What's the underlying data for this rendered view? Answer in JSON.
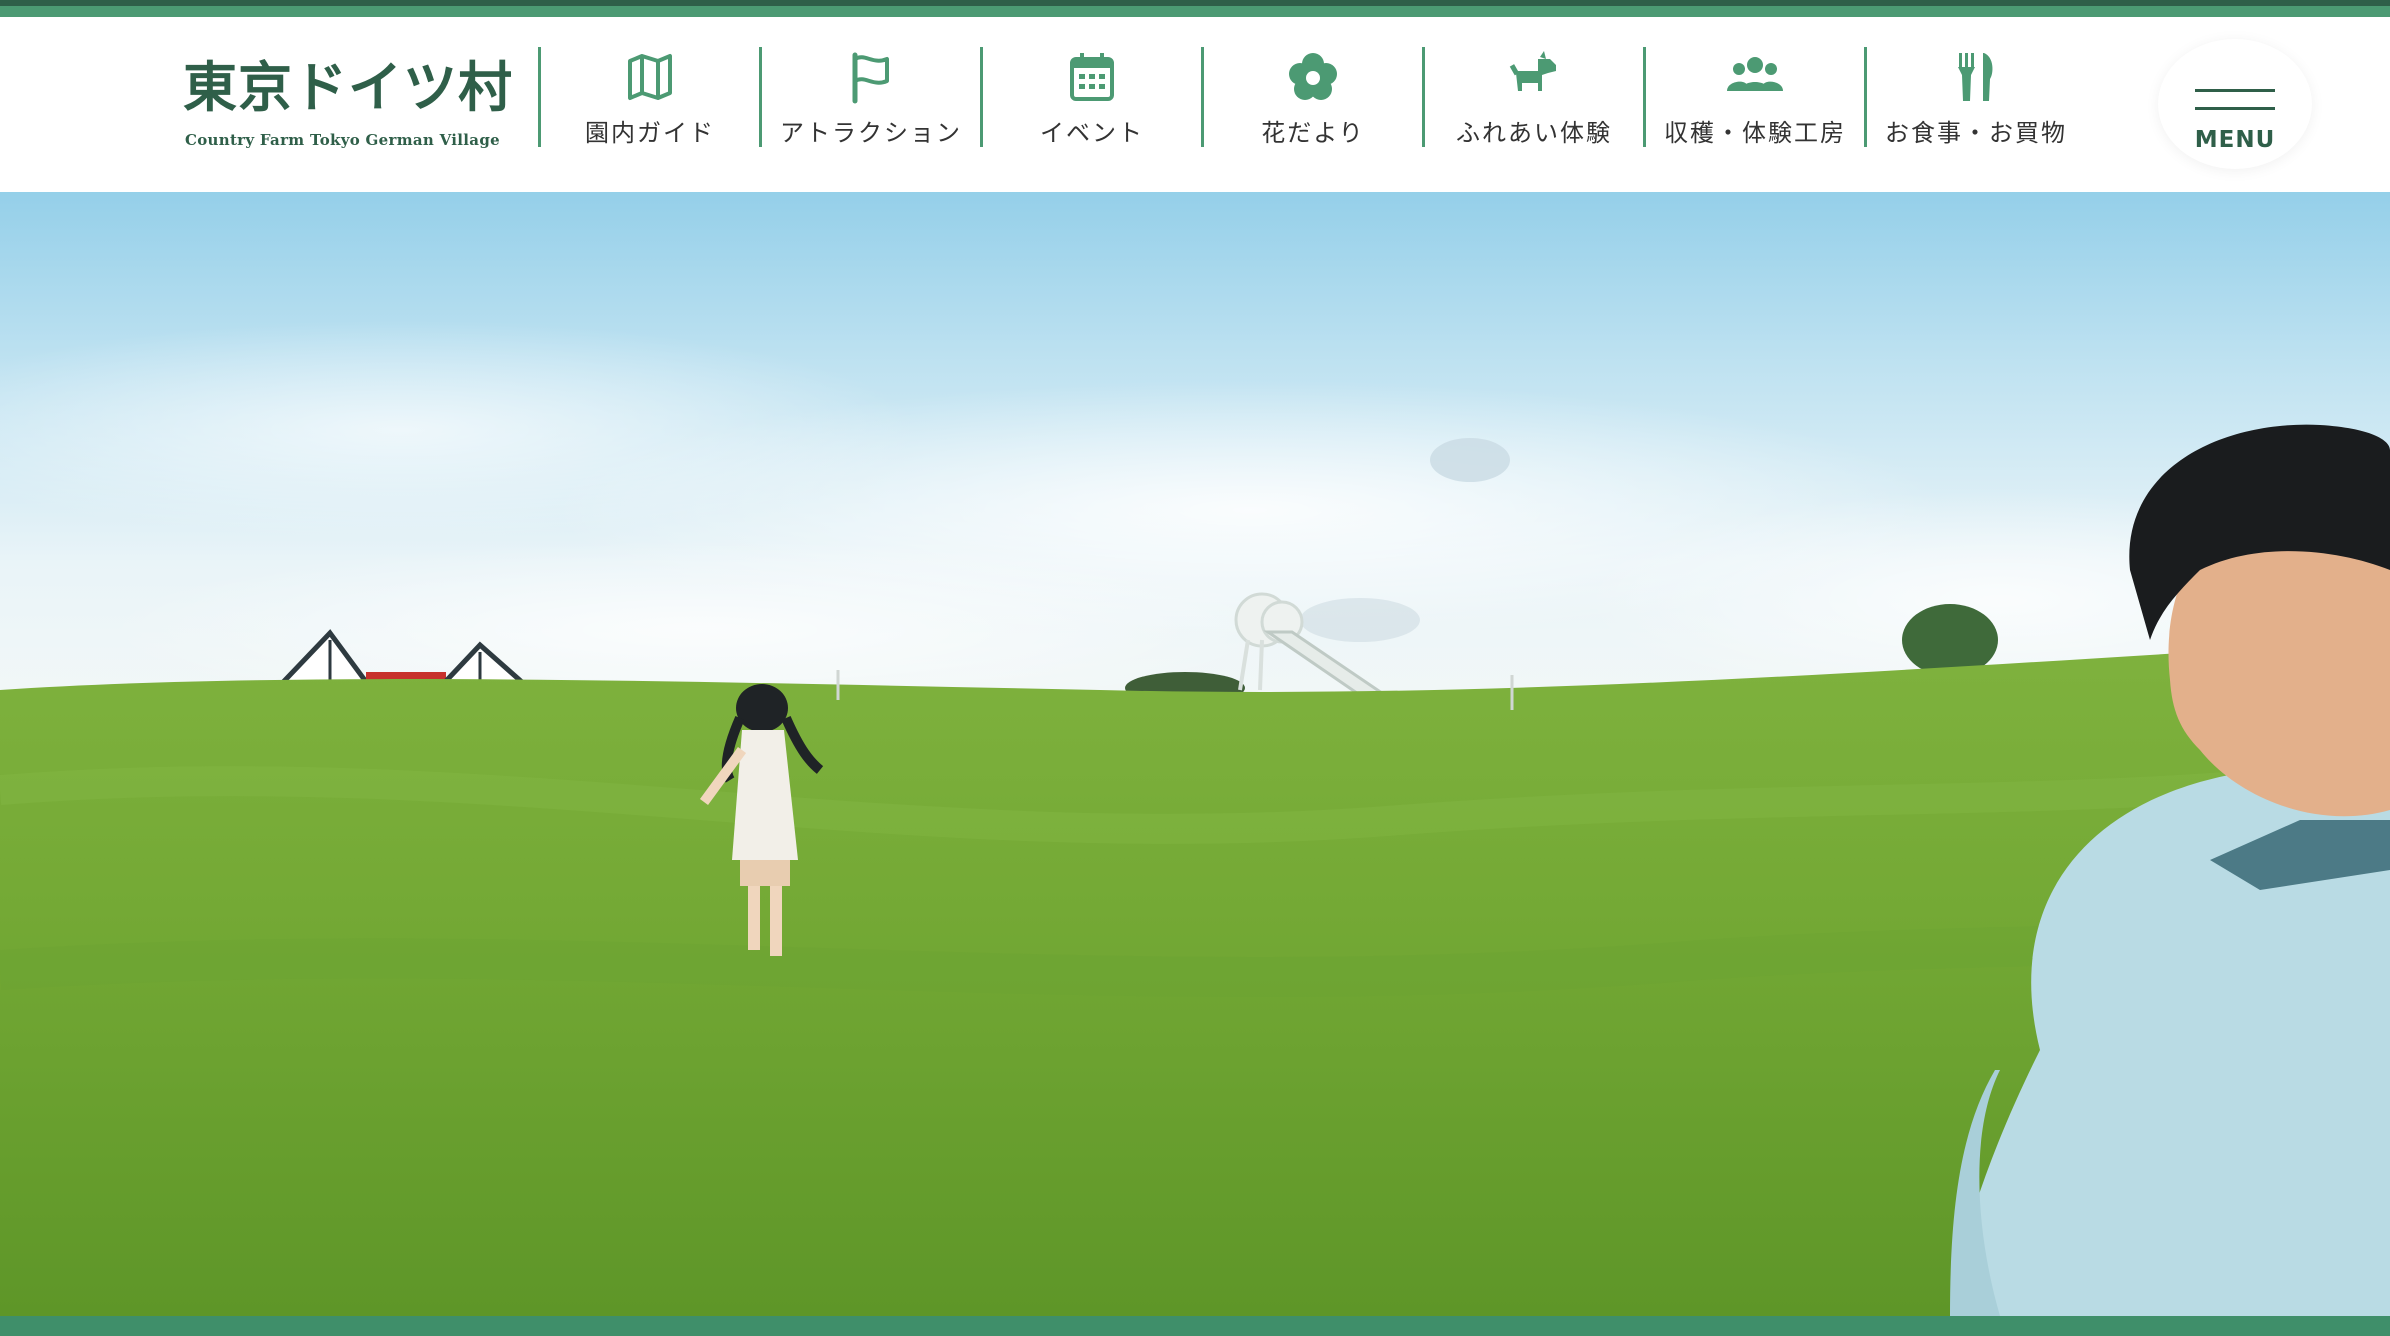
{
  "brand": {
    "name": "東京ドイツ村",
    "tagline": "Country Farm Tokyo German Village",
    "color_primary": "#2f5f49",
    "color_accent": "#4c9a73"
  },
  "nav": {
    "items": [
      {
        "label": "園内ガイド",
        "icon": "map-icon"
      },
      {
        "label": "アトラクション",
        "icon": "flag-icon"
      },
      {
        "label": "イベント",
        "icon": "calendar-icon"
      },
      {
        "label": "花だより",
        "icon": "flower-icon"
      },
      {
        "label": "ふれあい体験",
        "icon": "dog-icon"
      },
      {
        "label": "収穫・体験工房",
        "icon": "people-icon"
      },
      {
        "label": "お食事・お買物",
        "icon": "fork-knife-icon"
      }
    ]
  },
  "menu": {
    "label": "MENU",
    "icon": "hamburger-icon"
  }
}
